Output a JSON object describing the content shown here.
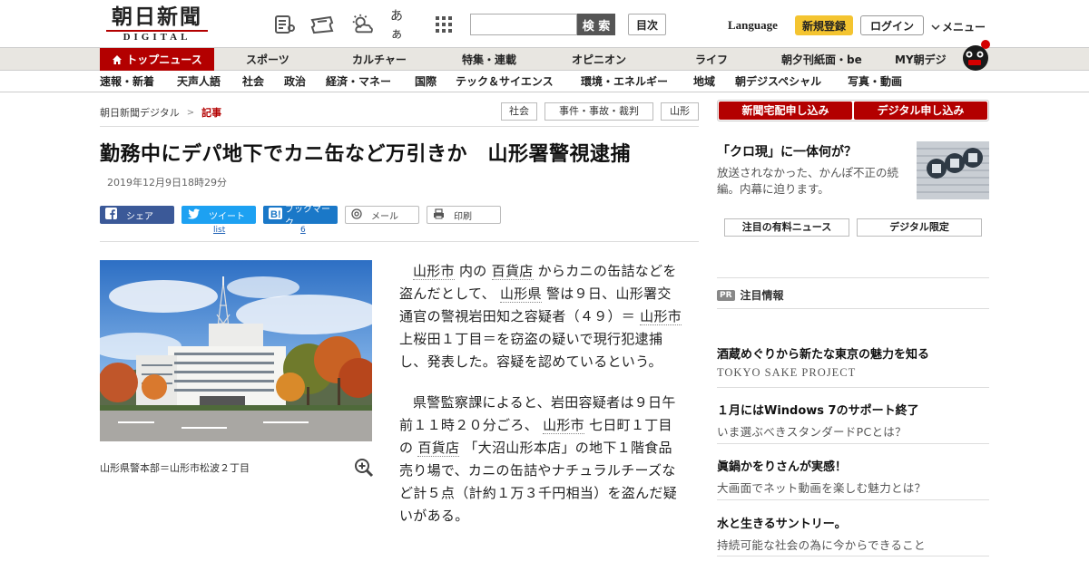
{
  "header": {
    "logo_jp": "朝日新聞",
    "logo_en": "DIGITAL",
    "font_size_icon_label": "あぁ",
    "search_button": "検 索",
    "toc_button": "目次",
    "language": "Language",
    "register": "新規登録",
    "login": "ログイン",
    "menu": "メニュー"
  },
  "nav_primary": [
    "トップニュース",
    "スポーツ",
    "カルチャー",
    "特集・連載",
    "オピニオン",
    "ライフ",
    "朝夕刊紙面・be",
    "MY朝デジ"
  ],
  "nav_secondary": [
    "速報・新着",
    "天声人語",
    "社会",
    "政治",
    "経済・マネー",
    "国際",
    "テック＆サイエンス",
    "環境・エネルギー",
    "地域",
    "朝デジスペシャル",
    "写真・動画"
  ],
  "breadcrumb": {
    "home": "朝日新聞デジタル",
    "sep": ">",
    "current": "記事"
  },
  "tags": [
    "社会",
    "事件・事故・裁判",
    "山形"
  ],
  "article": {
    "headline": "勤務中にデパ地下でカニ缶など万引きか　山形署警視逮捕",
    "date": "2019年12月9日18時29分",
    "photo_caption": "山形県警本部＝山形市松波２丁目",
    "p1": [
      {
        "text": "山形市",
        "kw": true
      },
      {
        "text": " 内の "
      },
      {
        "text": "百貨店",
        "kw": true
      },
      {
        "text": " からカニの缶詰などを盗んだとして、 "
      },
      {
        "text": "山形県",
        "kw": true
      },
      {
        "text": " 警は９日、山形署交通官の警視岩田知之容疑者（４９）＝ "
      },
      {
        "text": "山形市",
        "kw": true
      },
      {
        "text": " 上桜田１丁目＝を窃盗の疑いで現行犯逮捕し、発表した。容疑を認めているという。"
      }
    ],
    "p2": [
      {
        "text": "県警監察課によると、岩田容疑者は９日午前１１時２０分ごろ、 "
      },
      {
        "text": "山形市",
        "kw": true
      },
      {
        "text": " 七日町１丁目の "
      },
      {
        "text": "百貨店",
        "kw": true
      },
      {
        "text": " 「大沼山形本店」の地下１階食品売り場で、カニの缶詰やナチュラルチーズなど計５点（計約１万３千円相当）を盗んだ疑いがある。"
      }
    ]
  },
  "share": {
    "facebook": "シェア",
    "twitter": "ツイート",
    "twitter_count": "list",
    "hatena": "ブックマーク",
    "hatena_count": "6",
    "mail": "メール",
    "print": "印刷"
  },
  "sidebar": {
    "subscribe_paper": "新聞宅配申し込み",
    "subscribe_digital": "デジタル申し込み",
    "promo_title": "「クロ現」に一体何が？",
    "promo_text": "放送されなかった、かんぽ不正の続編。内幕に迫ります。",
    "paid_news": "注目の有料ニュース",
    "digital_only": "デジタル限定",
    "pr_badge": "PR",
    "pr_heading": "注目情報",
    "ads": [
      {
        "title": "酒蔵めぐりから新たな東京の魅力を知る",
        "sub": "TOKYO SAKE PROJECT"
      },
      {
        "title": "１月にはWindows 7のサポート終了",
        "sub": "いま選ぶべきスタンダードPCとは？"
      },
      {
        "title": "眞鍋かをりさんが実感！",
        "sub": "大画面でネット動画を楽しむ魅力とは？"
      },
      {
        "title": "水と生きるサントリー。",
        "sub": "持続可能な社会の為に今からできること"
      }
    ]
  },
  "colors": {
    "brand_red": "#b30000",
    "register_yellow": "#f4c430",
    "facebook": "#3b5998",
    "twitter": "#1da1f2",
    "hatena": "#1a78c8"
  }
}
